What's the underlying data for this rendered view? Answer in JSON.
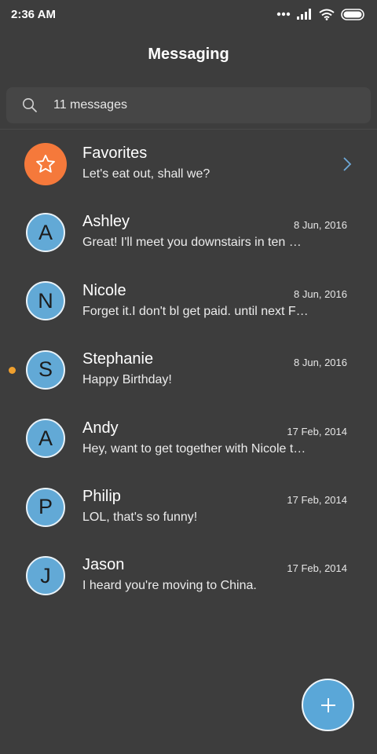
{
  "status_bar": {
    "time": "2:36 AM",
    "icons": [
      "more-dots-icon",
      "signal-icon",
      "wifi-icon",
      "battery-icon"
    ]
  },
  "header": {
    "title": "Messaging"
  },
  "search": {
    "text": "11 messages",
    "icon": "search-icon"
  },
  "favorites": {
    "name": "Favorites",
    "preview": "Let's eat out, shall we?",
    "icon": "star-icon",
    "color": "#f5793b"
  },
  "conversations": [
    {
      "initial": "A",
      "name": "Ashley",
      "date": "8 Jun, 2016",
      "preview": "Great! I'll meet you downstairs in ten minutes.",
      "unread": false
    },
    {
      "initial": "N",
      "name": "Nicole",
      "date": "8 Jun, 2016",
      "preview": "Forget it.I don't bl get paid. until next Friday",
      "unread": false
    },
    {
      "initial": "S",
      "name": "Stephanie",
      "date": "8 Jun, 2016",
      "preview": "Happy Birthday!",
      "unread": true
    },
    {
      "initial": "A",
      "name": "Andy",
      "date": "17 Feb, 2014",
      "preview": "Hey, want to get together with Nicole tonight?",
      "unread": false
    },
    {
      "initial": "P",
      "name": "Philip",
      "date": "17 Feb, 2014",
      "preview": "LOL, that's so funny!",
      "unread": false
    },
    {
      "initial": "J",
      "name": "Jason",
      "date": "17 Feb, 2014",
      "preview": "I heard you're moving to China.",
      "unread": false
    }
  ],
  "fab": {
    "label": "+",
    "icon": "plus-icon"
  },
  "colors": {
    "background": "#3d3d3d",
    "avatar": "#62a9d6",
    "favorites": "#f5793b",
    "unread_dot": "#f0a02e",
    "chevron": "#6ea9d8"
  }
}
